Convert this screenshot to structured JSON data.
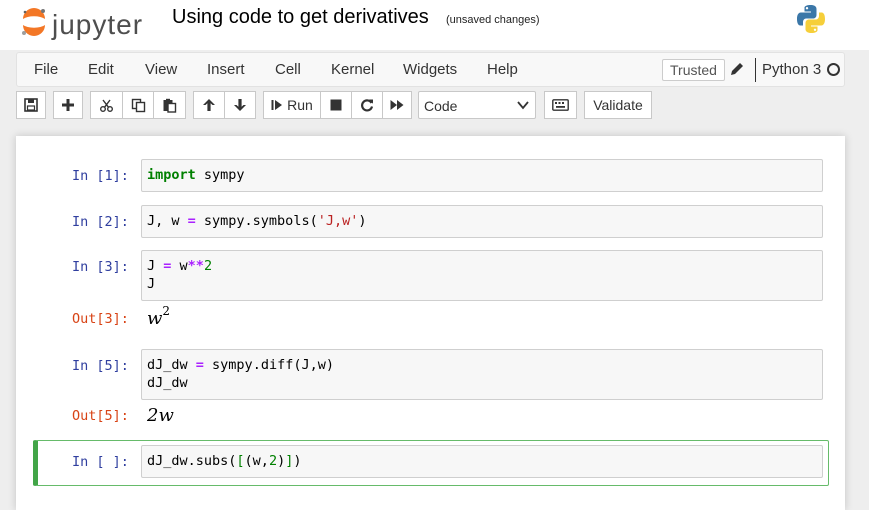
{
  "header": {
    "logo_text": "jupyter",
    "notebook_title": "Using code to get derivatives",
    "save_status": "(unsaved changes)"
  },
  "menubar": {
    "items": [
      "File",
      "Edit",
      "View",
      "Insert",
      "Cell",
      "Kernel",
      "Widgets",
      "Help"
    ],
    "trusted_label": "Trusted",
    "kernel_name": "Python 3"
  },
  "toolbar": {
    "run_label": "Run",
    "cell_type": "Code",
    "validate_label": "Validate"
  },
  "cells": [
    {
      "in_prompt": "In [1]:",
      "code_lines": [
        "import sympy"
      ]
    },
    {
      "in_prompt": "In [2]:",
      "code_lines": [
        "J, w = sympy.symbols('J,w')"
      ]
    },
    {
      "in_prompt": "In [3]:",
      "code_lines": [
        "J = w**2",
        "J"
      ],
      "out_prompt": "Out[3]:",
      "output_base": "w",
      "output_exp": "2"
    },
    {
      "in_prompt": "In [5]:",
      "code_lines": [
        "dJ_dw = sympy.diff(J,w)",
        "dJ_dw"
      ],
      "out_prompt": "Out[5]:",
      "output_text": "2w"
    },
    {
      "in_prompt": "In [ ]:",
      "code_lines": [
        "dJ_dw.subs([(w,2)])"
      ]
    }
  ],
  "colors": {
    "in_prompt": "#303f9f",
    "out_prompt": "#d84315",
    "keyword": "#008000",
    "operator": "#aa22ff",
    "string": "#ba2121",
    "selected_cell_border": "#42a548"
  }
}
